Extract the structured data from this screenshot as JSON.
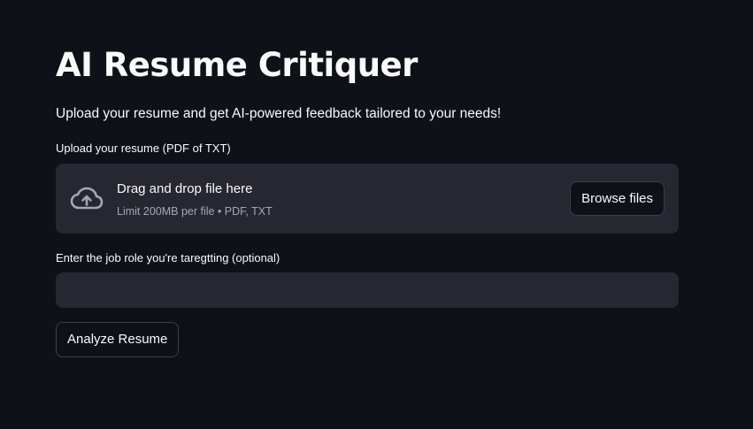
{
  "app": {
    "title": "AI Resume Critiquer",
    "subtitle": "Upload your resume and get AI-powered feedback tailored to your needs!"
  },
  "uploader": {
    "label": "Upload your resume (PDF of TXT)",
    "drop_text": "Drag and drop file here",
    "limit_text": "Limit 200MB per file • PDF, TXT",
    "browse_label": "Browse files",
    "icon": "cloud-upload-icon"
  },
  "job_role": {
    "label": "Enter the job role you're taregtting (optional)",
    "value": "",
    "placeholder": ""
  },
  "analyze_button": {
    "label": "Analyze Resume"
  },
  "colors": {
    "background": "#0e1117",
    "surface": "#262730",
    "text": "#fafafa",
    "muted_text": "#a3a8b4"
  }
}
